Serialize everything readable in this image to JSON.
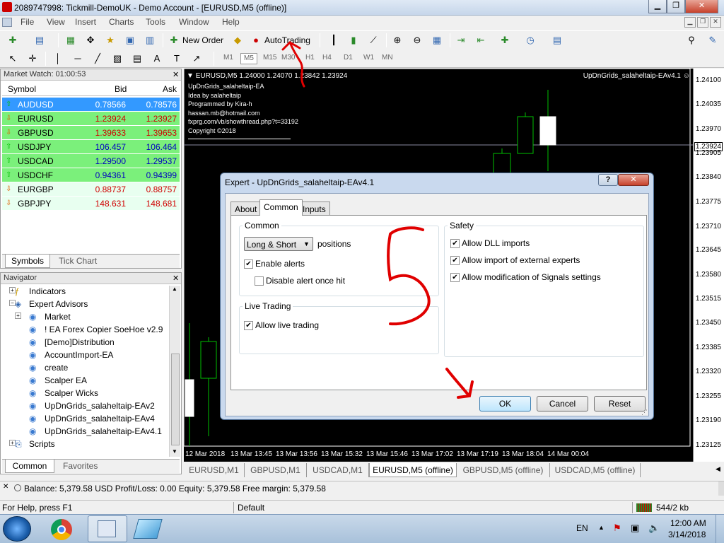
{
  "window": {
    "title": "2089747998: Tickmill-DemoUK - Demo Account - [EURUSD,M5 (offline)]"
  },
  "menu": [
    "File",
    "View",
    "Insert",
    "Charts",
    "Tools",
    "Window",
    "Help"
  ],
  "toolbar": {
    "new_order": "New Order",
    "autotrading": "AutoTrading",
    "timeframes": [
      "M1",
      "M5",
      "M15",
      "M30",
      "H1",
      "H4",
      "D1",
      "W1",
      "MN"
    ],
    "active_timeframe": "M5"
  },
  "market_watch": {
    "title": "Market Watch: 01:00:53",
    "headers": {
      "symbol": "Symbol",
      "bid": "Bid",
      "ask": "Ask"
    },
    "rows": [
      {
        "symbol": "AUDUSD",
        "bid": "0.78566",
        "ask": "0.78576",
        "dir": "up",
        "selected": true
      },
      {
        "symbol": "EURUSD",
        "bid": "1.23924",
        "ask": "1.23927",
        "dir": "down",
        "selected": false
      },
      {
        "symbol": "GBPUSD",
        "bid": "1.39633",
        "ask": "1.39653",
        "dir": "down",
        "selected": false
      },
      {
        "symbol": "USDJPY",
        "bid": "106.457",
        "ask": "106.464",
        "dir": "up",
        "selected": false
      },
      {
        "symbol": "USDCAD",
        "bid": "1.29500",
        "ask": "1.29537",
        "dir": "up",
        "selected": false
      },
      {
        "symbol": "USDCHF",
        "bid": "0.94361",
        "ask": "0.94399",
        "dir": "up",
        "selected": false
      },
      {
        "symbol": "EURGBP",
        "bid": "0.88737",
        "ask": "0.88757",
        "dir": "down",
        "selected": false
      },
      {
        "symbol": "GBPJPY",
        "bid": "148.631",
        "ask": "148.681",
        "dir": "down",
        "selected": false
      }
    ],
    "tabs": [
      "Symbols",
      "Tick Chart"
    ]
  },
  "navigator": {
    "title": "Navigator",
    "items": [
      {
        "label": "Indicators",
        "level": 1
      },
      {
        "label": "Expert Advisors",
        "level": 1
      },
      {
        "label": "Market",
        "level": 2
      },
      {
        "label": "! EA Forex Copier SoeHoe v2.9",
        "level": 2
      },
      {
        "label": "[Demo]Distribution",
        "level": 2
      },
      {
        "label": "AccountImport-EA",
        "level": 2
      },
      {
        "label": "create",
        "level": 2
      },
      {
        "label": "Scalper EA",
        "level": 2
      },
      {
        "label": "Scalper Wicks",
        "level": 2
      },
      {
        "label": "UpDnGrids_salaheltaip-EAv2",
        "level": 2
      },
      {
        "label": "UpDnGrids_salaheltaip-EAv4",
        "level": 2
      },
      {
        "label": "UpDnGrids_salaheltaip-EAv4.1",
        "level": 2
      },
      {
        "label": "Scripts",
        "level": 1
      }
    ],
    "tabs": [
      "Common",
      "Favorites"
    ]
  },
  "chart": {
    "header": "EURUSD,M5  1.24000 1.24070 1.23842 1.23924",
    "info": [
      "UpDnGrids_salaheltaip-EA",
      "Idea by salaheltaip",
      "Programmed by Kira-h",
      "hassan.mb@hotmail.com",
      "fxprg.com/vb/showthread.php?t=33192",
      "Copyright ©2018"
    ],
    "ea_label": "UpDnGrids_salaheltaip-EAv4.1",
    "price_labels": [
      "1.24100",
      "1.24035",
      "1.23970",
      "1.23924",
      "1.23905",
      "1.23840",
      "1.23775",
      "1.23710",
      "1.23645",
      "1.23580",
      "1.23515",
      "1.23450",
      "1.23385",
      "1.23320",
      "1.23255",
      "1.23190",
      "1.23125"
    ],
    "current_price": "1.23924",
    "time_labels": [
      "12 Mar 2018",
      "13 Mar 13:45",
      "13 Mar 13:56",
      "13 Mar 15:32",
      "13 Mar 15:46",
      "13 Mar 17:02",
      "13 Mar 17:19",
      "13 Mar 18:04",
      "14 Mar 00:04"
    ],
    "tabs": [
      "EURUSD,M1",
      "GBPUSD,M1",
      "USDCAD,M1",
      "EURUSD,M5 (offline)",
      "GBPUSD,M5 (offline)",
      "USDCAD,M5 (offline)"
    ],
    "active_tab": "EURUSD,M5 (offline)"
  },
  "dialog": {
    "title": "Expert - UpDnGrids_salaheltaip-EAv4.1",
    "help": "?",
    "close": "✕",
    "tabs": [
      "About",
      "Common",
      "Inputs"
    ],
    "active_tab": "Common",
    "common": {
      "title": "Common",
      "positions_value": "Long & Short",
      "positions_label": "positions",
      "enable_alerts": "Enable alerts",
      "disable_alert": "Disable alert once hit"
    },
    "live": {
      "title": "Live Trading",
      "allow_live": "Allow live trading"
    },
    "safety": {
      "title": "Safety",
      "allow_dll": "Allow DLL imports",
      "allow_import": "Allow import of external experts",
      "allow_signals": "Allow modification of Signals settings"
    },
    "buttons": {
      "ok": "OK",
      "cancel": "Cancel",
      "reset": "Reset"
    }
  },
  "status": {
    "text": "Balance: 5,379.58 USD  Profit/Loss: 0.00  Equity: 5,379.58  Free margin: 5,379.58"
  },
  "bottom": {
    "help": "For Help, press F1",
    "profile": "Default",
    "traffic": "544/2 kb"
  },
  "taskbar": {
    "lang": "EN",
    "time": "12:00 AM",
    "date": "3/14/2018"
  },
  "colors": {
    "up": "#00c000",
    "down": "#ff2020",
    "bid_blue": "#0000c0",
    "bid_red": "#d00000",
    "row_green": "#7bf07b",
    "row_light": "#e8fff0",
    "selected": "#3399ff",
    "annotation": "#e00000"
  }
}
